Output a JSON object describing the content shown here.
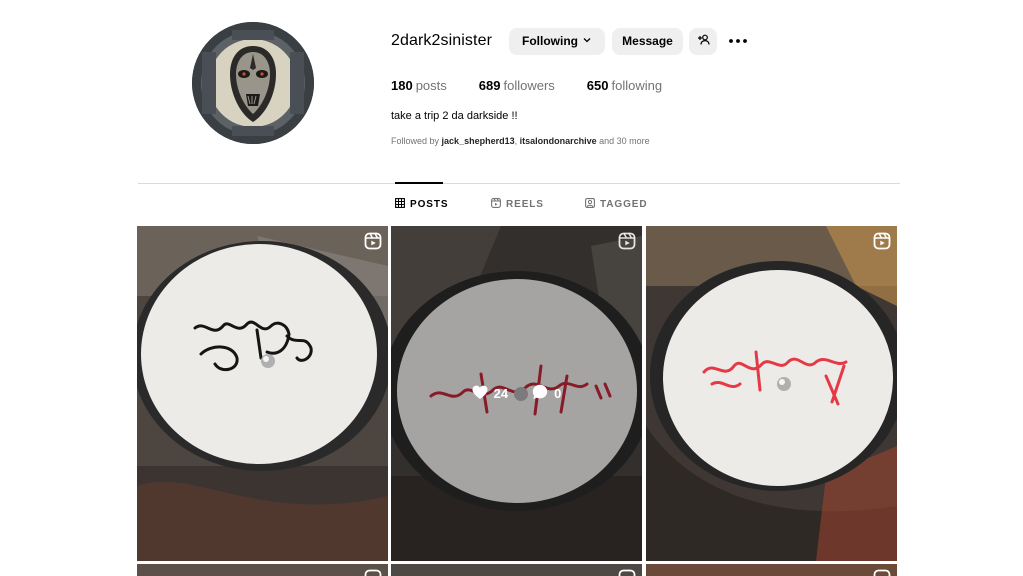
{
  "profile": {
    "username": "2dark2sinister",
    "following_label": "Following",
    "message_label": "Message",
    "posts_count": "180",
    "posts_label": "posts",
    "followers_count": "689",
    "followers_label": "followers",
    "following_count": "650",
    "following_text": "following",
    "bio": "take a trip 2 da darkside !!",
    "followed_by_prefix": "Followed by",
    "followed_by_user1": "jack_shepherd13",
    "followed_by_user2": "itsalondonarchive",
    "followed_by_suffix": "and 30 more"
  },
  "tabs": [
    {
      "label": "POSTS",
      "icon": "grid-icon",
      "active": true
    },
    {
      "label": "REELS",
      "icon": "reels-icon",
      "active": false
    },
    {
      "label": "TAGGED",
      "icon": "tagged-icon",
      "active": false
    }
  ],
  "posts": [
    {
      "type": "reel",
      "tag_text_color": "#111111"
    },
    {
      "type": "reel",
      "likes": "24",
      "comments": "0",
      "tag_text_color": "#c2283a"
    },
    {
      "type": "reel",
      "tag_text_color": "#e63946"
    }
  ],
  "colors": {
    "button_bg": "#efefef",
    "divider": "#dbdbdb",
    "muted_text": "#737373"
  }
}
